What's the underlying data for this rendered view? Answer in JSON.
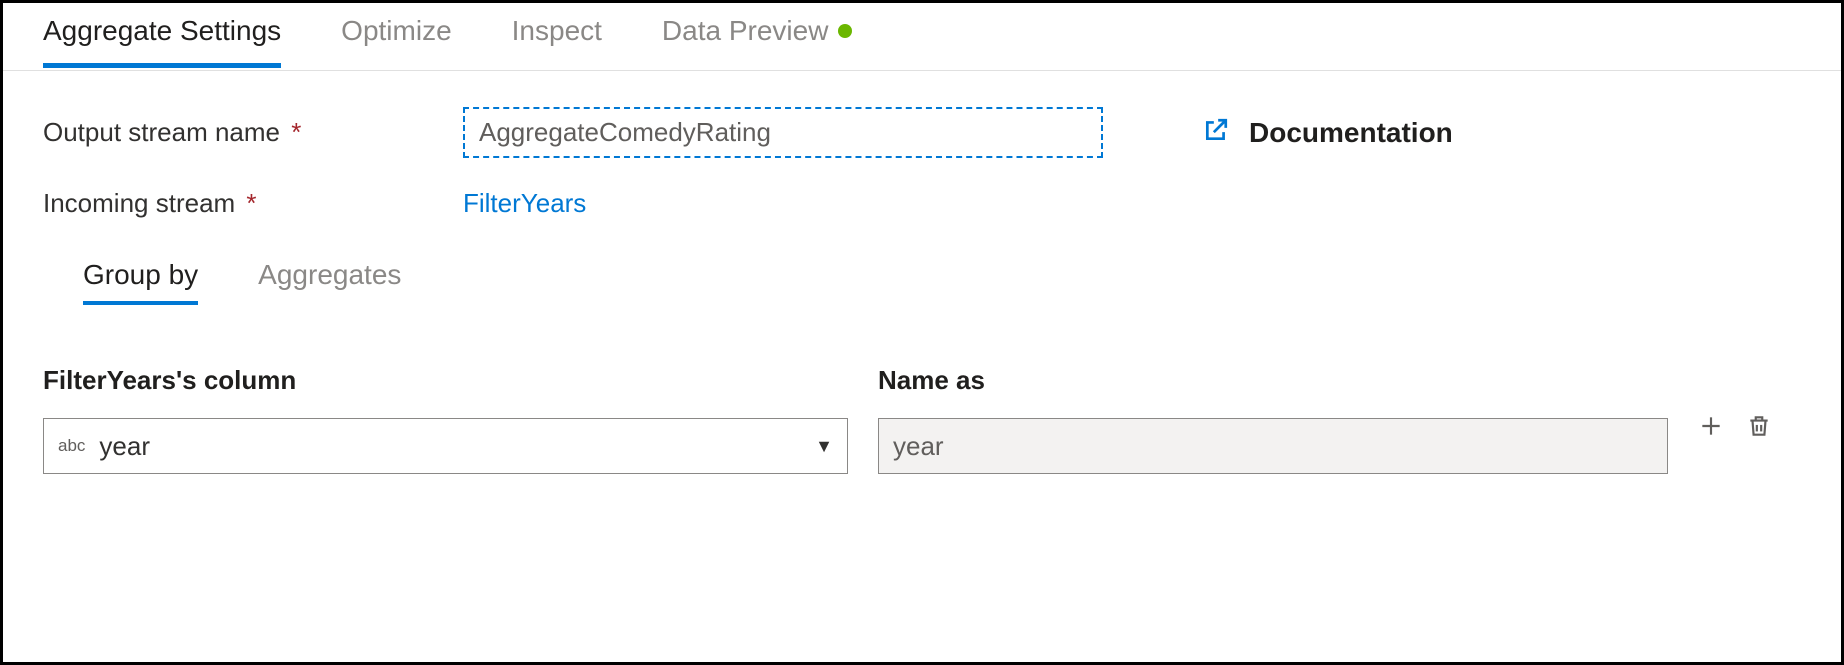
{
  "tabs": {
    "aggregate_settings": "Aggregate Settings",
    "optimize": "Optimize",
    "inspect": "Inspect",
    "data_preview": "Data Preview"
  },
  "fields": {
    "output_stream_label": "Output stream name",
    "output_stream_value": "AggregateComedyRating",
    "incoming_stream_label": "Incoming stream",
    "incoming_stream_value": "FilterYears"
  },
  "documentation": {
    "label": "Documentation"
  },
  "subtabs": {
    "group_by": "Group by",
    "aggregates": "Aggregates"
  },
  "group_by": {
    "column_header": "FilterYears's column",
    "name_header": "Name as",
    "type_badge": "abc",
    "column_value": "year",
    "name_value": "year"
  }
}
